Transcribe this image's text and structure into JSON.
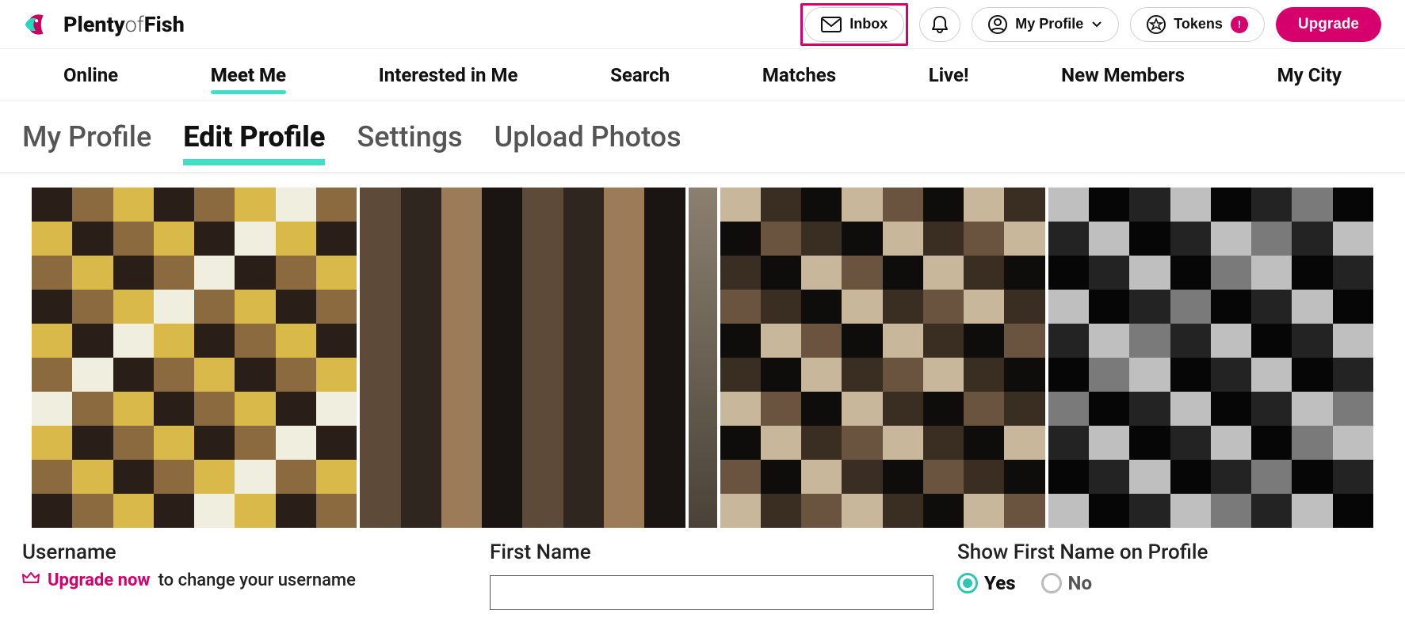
{
  "brand": {
    "name_bold1": "Plenty",
    "name_light": "of",
    "name_bold2": "Fish"
  },
  "top": {
    "inbox": "Inbox",
    "my_profile": "My Profile",
    "tokens": "Tokens",
    "upgrade": "Upgrade",
    "badge": "!"
  },
  "nav": {
    "items": [
      {
        "label": "Online"
      },
      {
        "label": "Meet Me",
        "active": true
      },
      {
        "label": "Interested in Me"
      },
      {
        "label": "Search"
      },
      {
        "label": "Matches"
      },
      {
        "label": "Live!"
      },
      {
        "label": "New Members"
      },
      {
        "label": "My City"
      }
    ]
  },
  "subtabs": {
    "items": [
      {
        "label": "My Profile"
      },
      {
        "label": "Edit Profile",
        "active": true
      },
      {
        "label": "Settings"
      },
      {
        "label": "Upload Photos"
      }
    ]
  },
  "form": {
    "username_label": "Username",
    "upgrade_link": "Upgrade now",
    "upgrade_rest": "to change your username",
    "firstname_label": "First Name",
    "firstname_value": "",
    "show_label": "Show First Name on Profile",
    "opt_yes": "Yes",
    "opt_no": "No"
  }
}
